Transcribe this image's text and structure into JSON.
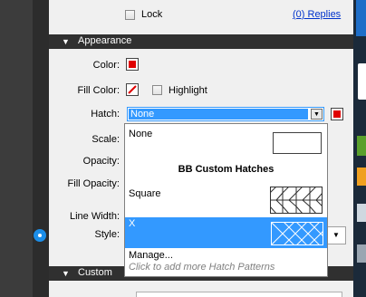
{
  "panel": {
    "lock_label": "Lock",
    "replies_link": "(0) Replies",
    "appearance_header": "Appearance",
    "custom_header": "Custom",
    "color_label": "Color:",
    "fill_color_label": "Fill Color:",
    "highlight_label": "Highlight",
    "hatch_label": "Hatch:",
    "scale_label": "Scale:",
    "opacity_label": "Opacity:",
    "fill_opacity_label": "Fill Opacity:",
    "line_width_label": "Line Width:",
    "style_label": "Style:",
    "color_value": "#e00000"
  },
  "hatch_combo": {
    "selected": "None"
  },
  "dropdown": {
    "option_none": "None",
    "group_header": "BB Custom Hatches",
    "option_square": "Square",
    "option_x": "X",
    "manage": "Manage...",
    "hint": "Click to add more Hatch Patterns"
  }
}
